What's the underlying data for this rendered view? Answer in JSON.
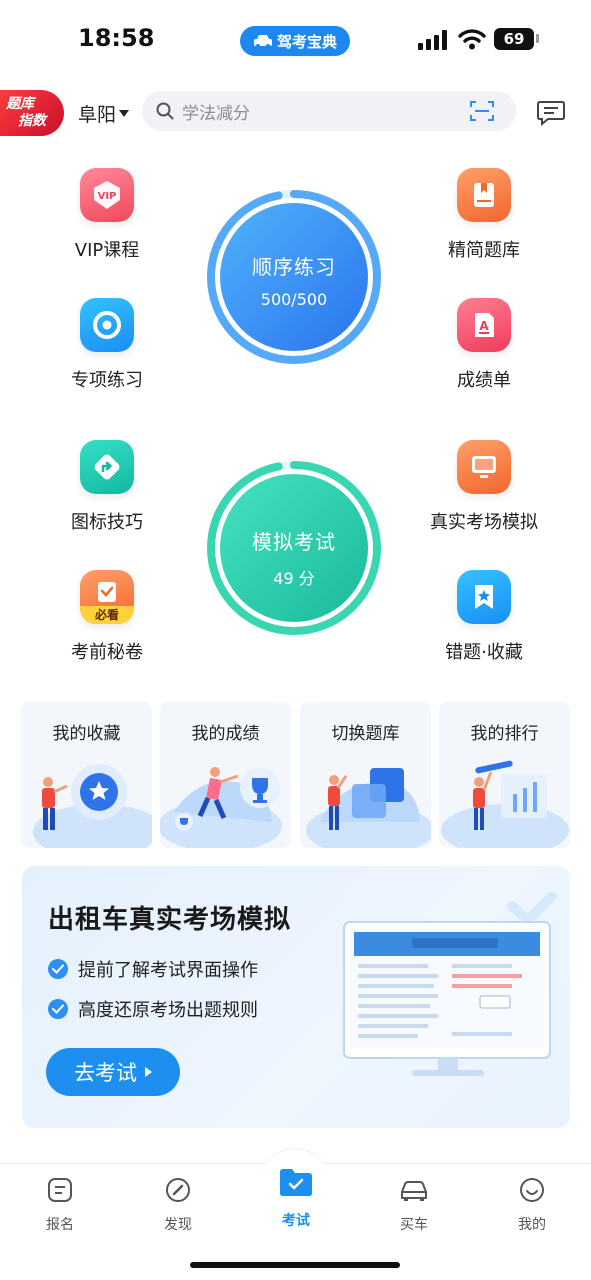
{
  "status_bar": {
    "time": "18:58",
    "app_pill": "驾考宝典",
    "battery": "69"
  },
  "header": {
    "badge_line1": "题库",
    "badge_line2": "指数",
    "city": "阜阳",
    "search_placeholder": "学法减分"
  },
  "features": {
    "vip": "VIP课程",
    "refined": "精简题库",
    "special": "专项练习",
    "report": "成绩单",
    "icon_tips": "图标技巧",
    "real_exam": "真实考场模拟",
    "secret": "考前秘卷",
    "secret_tag": "必看",
    "mistakes": "错题·收藏"
  },
  "practice": {
    "title": "顺序练习",
    "progress": "500/500",
    "progress_fraction": 0.97
  },
  "mock": {
    "title": "模拟考试",
    "score": "49 分",
    "progress_fraction": 0.97
  },
  "quick_cards": [
    {
      "label": "我的收藏"
    },
    {
      "label": "我的成绩"
    },
    {
      "label": "切换题库"
    },
    {
      "label": "我的排行"
    }
  ],
  "banner": {
    "title": "出租车真实考场模拟",
    "point1": "提前了解考试界面操作",
    "point2": "高度还原考场出题规则",
    "button": "去考试"
  },
  "tabs": [
    {
      "label": "报名"
    },
    {
      "label": "发现"
    },
    {
      "label": "考试"
    },
    {
      "label": "买车"
    },
    {
      "label": "我的"
    }
  ],
  "colors": {
    "accent": "#1f8ef1",
    "practice_blue": "#3d8ff5",
    "mock_green": "#2fcfa9",
    "active_tab": "#1f8ef1"
  }
}
